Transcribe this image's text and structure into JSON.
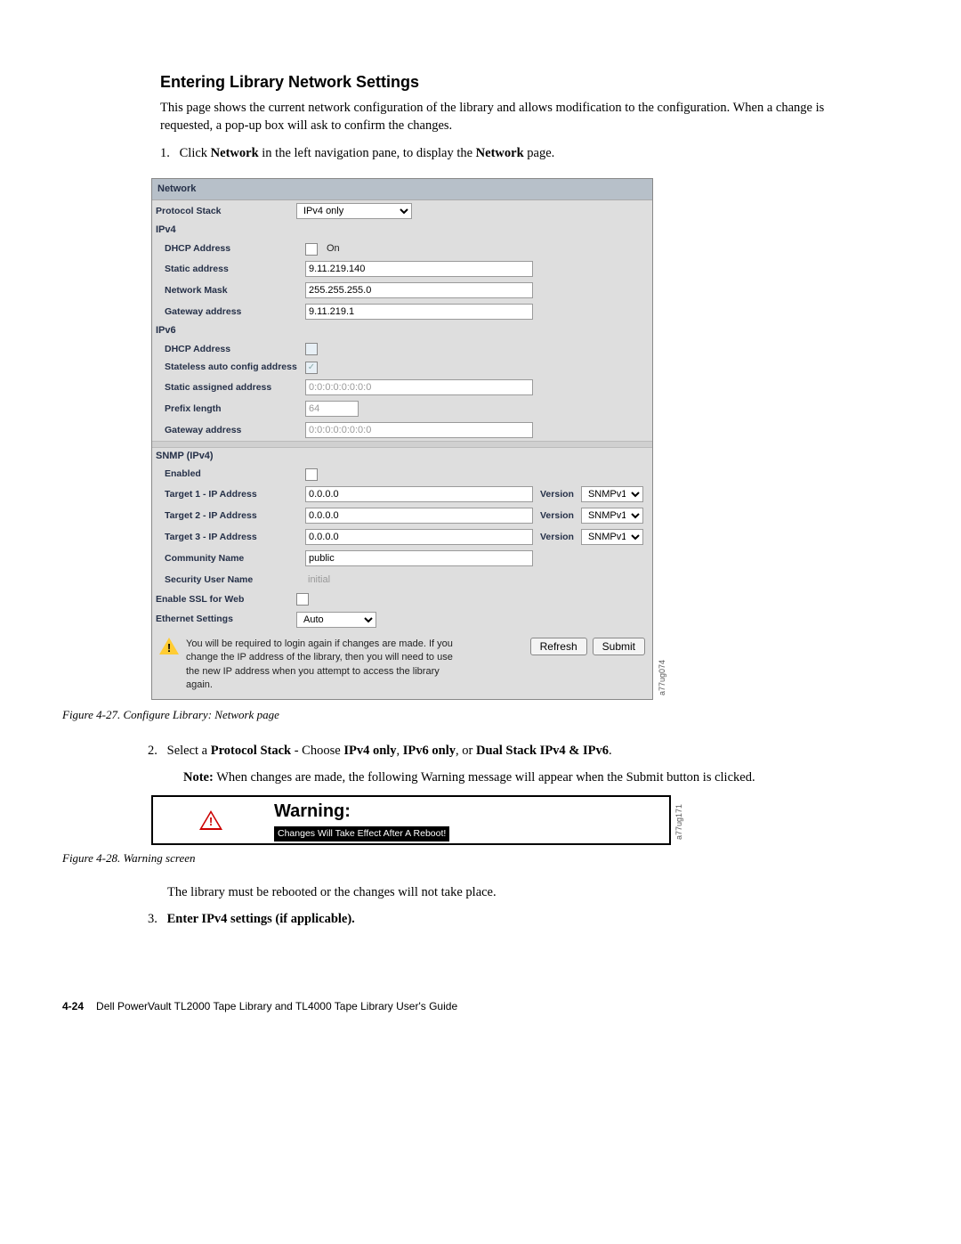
{
  "heading": "Entering Library Network Settings",
  "intro": "This page shows the current network configuration of the library and allows modification to the configuration. When a change is requested, a pop-up box will ask to confirm the changes.",
  "step1_num": "1.",
  "step1_pre": "Click ",
  "step1_b1": "Network",
  "step1_mid": " in the left navigation pane, to display the ",
  "step1_b2": "Network",
  "step1_post": " page.",
  "panel": {
    "title": "Network",
    "protocol_label": "Protocol Stack",
    "protocol_value": "IPv4 only",
    "ipv4_label": "IPv4",
    "dhcp_label": "DHCP Address",
    "dhcp_on": "On",
    "static_label": "Static address",
    "static_value": "9.11.219.140",
    "mask_label": "Network Mask",
    "mask_value": "255.255.255.0",
    "gw_label": "Gateway address",
    "gw_value": "9.11.219.1",
    "ipv6_label": "IPv6",
    "dhcp6_label": "DHCP Address",
    "slaac_label": "Stateless auto config address",
    "static6_label": "Static assigned address",
    "static6_value": "0:0:0:0:0:0:0:0",
    "prefix_label": "Prefix length",
    "prefix_value": "64",
    "gw6_label": "Gateway address",
    "gw6_value": "0:0:0:0:0:0:0:0",
    "snmp_label": "SNMP (IPv4)",
    "snmp_enabled": "Enabled",
    "t1_label": "Target 1 - IP Address",
    "t1_value": "0.0.0.0",
    "t2_label": "Target 2 - IP Address",
    "t2_value": "0.0.0.0",
    "t3_label": "Target 3 - IP Address",
    "t3_value": "0.0.0.0",
    "version_label": "Version",
    "version_value": "SNMPv1",
    "comm_label": "Community Name",
    "comm_value": "public",
    "sec_label": "Security User Name",
    "sec_value": "initial",
    "ssl_label": "Enable SSL for Web",
    "eth_label": "Ethernet Settings",
    "eth_value": "Auto",
    "warn_text": "You will be required to login again if changes are made. If you change the IP address of the library, then you will need to use the new IP address when you attempt to access the library again.",
    "refresh": "Refresh",
    "submit": "Submit",
    "sidecode": "a77ug074"
  },
  "fig1_caption": "Figure 4-27. Configure Library: Network page",
  "step2_num": "2.",
  "step2_pre": "Select a ",
  "step2_b1": "Protocol Stack",
  "step2_mid1": " - Choose ",
  "step2_b2": "IPv4 only",
  "step2_mid2": ", ",
  "step2_b3": "IPv6 only",
  "step2_mid3": ", or ",
  "step2_b4": "Dual Stack IPv4 & IPv6",
  "step2_post": ".",
  "note_label": "Note:",
  "note_text": " When changes are made, the following Warning message will appear when the Submit button is clicked.",
  "warning_title": "Warning:",
  "warning_msg": "Changes Will Take Effect After A Reboot!",
  "warning_sidecode": "a77ug171",
  "fig2_caption": "Figure 4-28. Warning screen",
  "after_warn": "The library must be rebooted or the changes will not take place.",
  "step3_num": "3.",
  "step3_b": "Enter IPv4 settings (if applicable).",
  "footer_page": "4-24",
  "footer_text": "Dell PowerVault TL2000 Tape Library and TL4000 Tape Library User's Guide"
}
